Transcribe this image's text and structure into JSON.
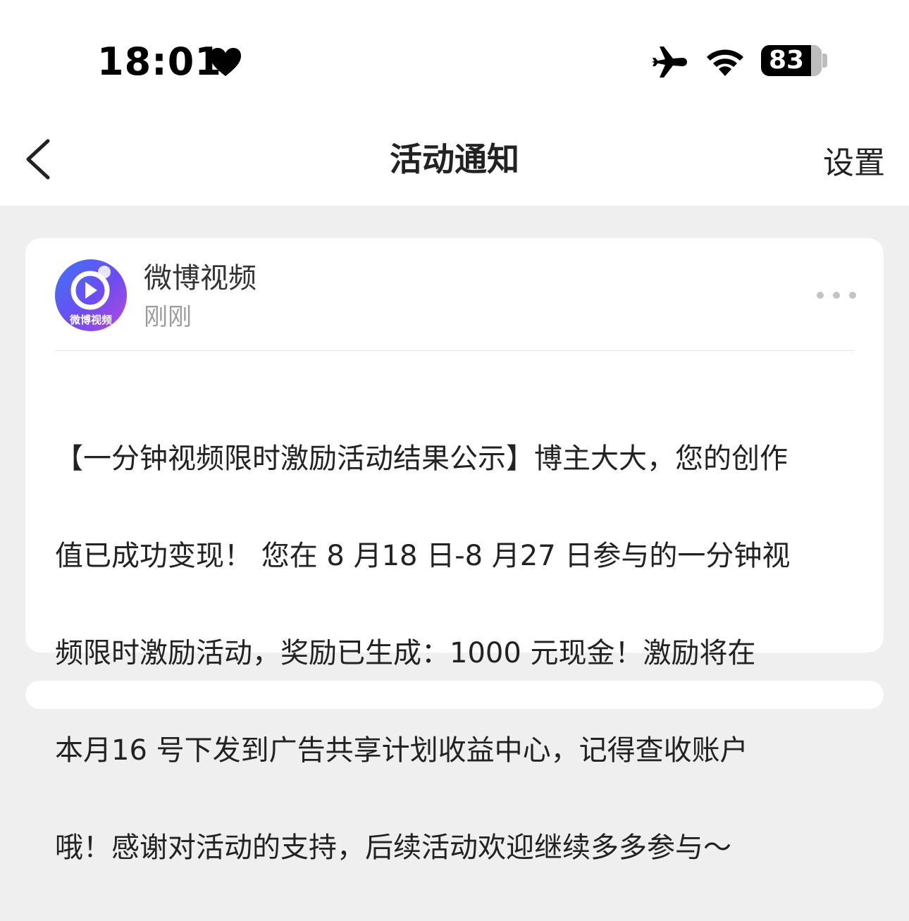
{
  "status_bar": {
    "time": "18:01",
    "battery_level": "83",
    "battery_fraction": 0.83,
    "icons": [
      "heart-icon",
      "airplane-icon",
      "wifi-icon",
      "battery-icon"
    ]
  },
  "nav": {
    "title": "活动通知",
    "right_label": "设置",
    "back_icon": "chevron-left-icon"
  },
  "notification": {
    "avatar_label": "微博视频",
    "sender": "微博视频",
    "time": "刚刚",
    "more_icon": "more-dots-icon",
    "lines": [
      "【一分钟视频限时激励活动结果公示】博主大大，您的创作",
      "值已成功变现！ 您在 8 月18 日-8 月27 日参与的一分钟视",
      "频限时激励活动，奖励已生成：1000 元现金！激励将在",
      "本月16 号下发到广告共享计划收益中心，记得查收账户",
      "哦！感谢对活动的支持，后续活动欢迎继续多多参与～"
    ]
  },
  "colors": {
    "page_background": "#efefef",
    "card_background": "#ffffff",
    "avatar_gradient": [
      "#3f74f5",
      "#6d4cf1",
      "#b84ad8"
    ],
    "secondary_text": "#9b9b9b"
  }
}
